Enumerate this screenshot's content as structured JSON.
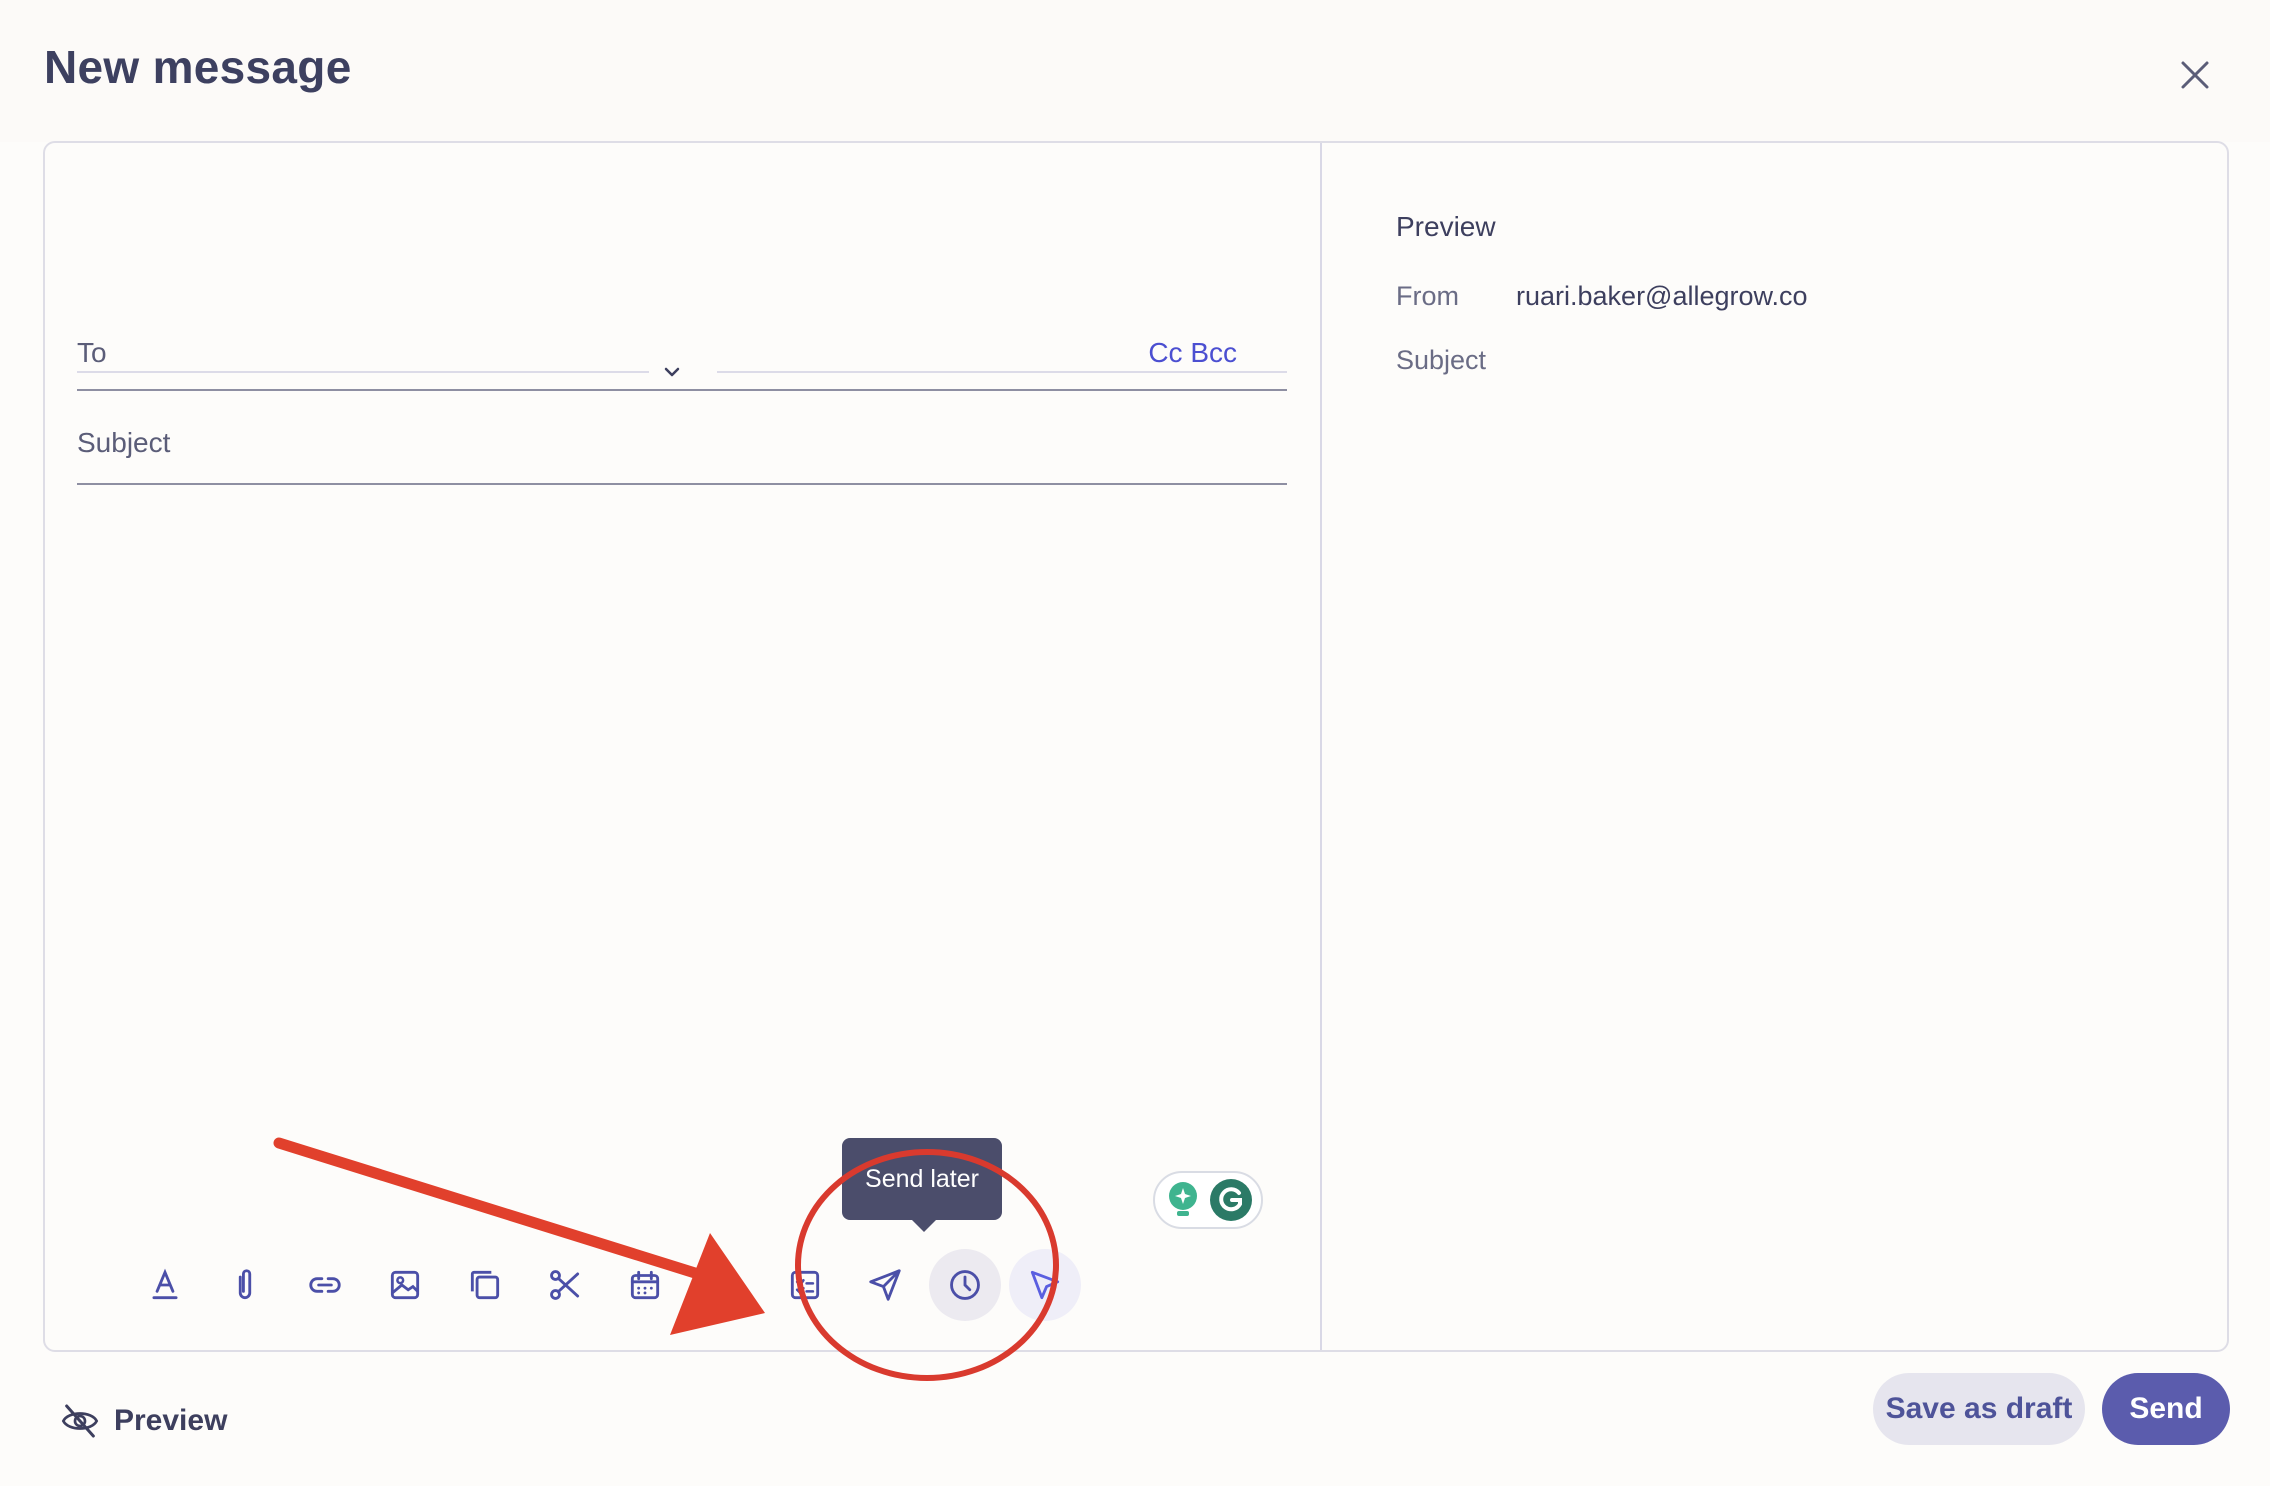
{
  "header": {
    "title": "New message"
  },
  "compose": {
    "to_label": "To",
    "to_value": "",
    "cc_bcc_label": "Cc Bcc",
    "subject_label": "Subject",
    "subject_value": "",
    "send_later_tooltip": "Send later",
    "toolbar_icons": [
      "text-format-icon",
      "attachment-icon",
      "link-icon",
      "image-icon",
      "copy-icon",
      "scissors-icon",
      "calendar-icon",
      "curly-braces-icon",
      "checklist-icon",
      "send-icon",
      "clock-icon",
      "cursor-arrow-icon"
    ]
  },
  "preview": {
    "title": "Preview",
    "from_label": "From",
    "from_value": "ruari.baker@allegrow.co",
    "subject_label": "Subject",
    "subject_value": ""
  },
  "footer": {
    "preview_toggle_label": "Preview",
    "save_draft_label": "Save as draft",
    "send_label": "Send"
  },
  "colors": {
    "accent": "#5b5cad",
    "link": "#4b4fd1",
    "annotation": "#d93a2e",
    "tooltip_bg": "#4b4d6b",
    "text": "#3d3f5e"
  }
}
